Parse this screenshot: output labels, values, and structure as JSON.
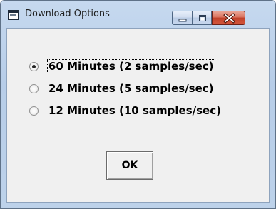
{
  "window": {
    "title": "Download Options",
    "icon": "dialog-icon",
    "controls": [
      "minimize-icon",
      "maximize-icon",
      "close-icon"
    ]
  },
  "options": [
    {
      "label": "60 Minutes (2 samples/sec)",
      "selected": true
    },
    {
      "label": "24 Minutes (5 samples/sec)",
      "selected": false
    },
    {
      "label": "12 Minutes (10 samples/sec)",
      "selected": false
    }
  ],
  "ok_button": {
    "label": "OK"
  },
  "colors": {
    "titlebar": "#bcd1ea",
    "client": "#f0f0f0",
    "close": "#c9543c"
  }
}
